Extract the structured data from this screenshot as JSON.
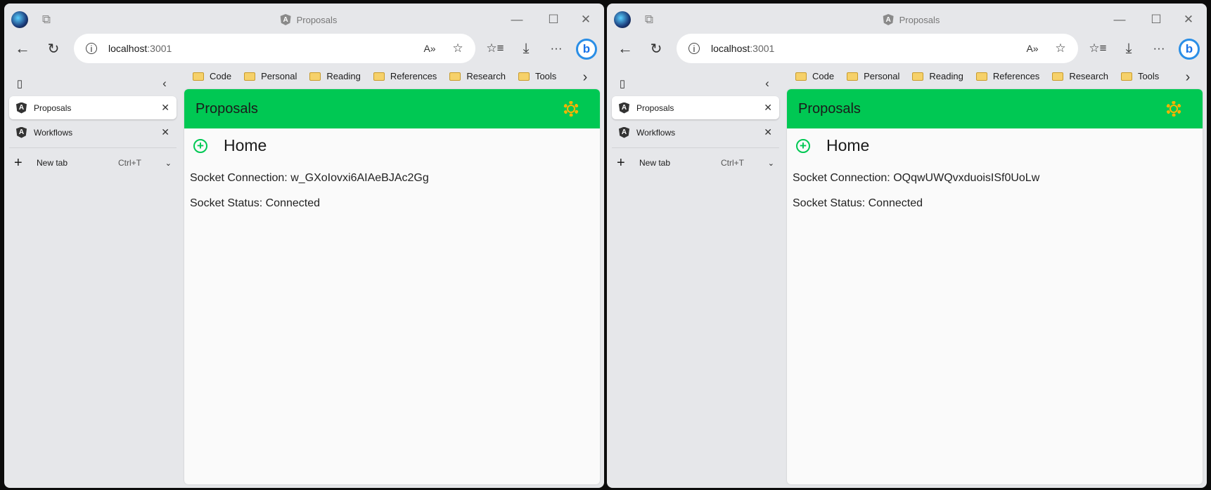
{
  "windows": [
    {
      "title": "Proposals",
      "url_host": "localhost",
      "url_port": ":3001",
      "bookmarks": [
        "Code",
        "Personal",
        "Reading",
        "References",
        "Research",
        "Tools"
      ],
      "tabs": [
        {
          "label": "Proposals",
          "active": true
        },
        {
          "label": "Workflows",
          "active": false
        }
      ],
      "new_tab": {
        "label": "New tab",
        "shortcut": "Ctrl+T"
      },
      "app": {
        "header": "Proposals",
        "home": "Home",
        "socket_connection": "Socket Connection: w_GXoIovxi6AIAeBJAc2Gg",
        "socket_status": "Socket Status: Connected"
      }
    },
    {
      "title": "Proposals",
      "url_host": "localhost",
      "url_port": ":3001",
      "bookmarks": [
        "Code",
        "Personal",
        "Reading",
        "References",
        "Research",
        "Tools"
      ],
      "tabs": [
        {
          "label": "Proposals",
          "active": true
        },
        {
          "label": "Workflows",
          "active": false
        }
      ],
      "new_tab": {
        "label": "New tab",
        "shortcut": "Ctrl+T"
      },
      "app": {
        "header": "Proposals",
        "home": "Home",
        "socket_connection": "Socket Connection: OQqwUWQvxduoisISf0UoLw",
        "socket_status": "Socket Status: Connected"
      }
    }
  ],
  "colors": {
    "app_header": "#00c853",
    "theme_icon": "#ffb300",
    "add_icon": "#00c853"
  },
  "icons": {
    "theme_toggle": "sun-icon",
    "add": "plus-circle-icon",
    "tab_favicon": "angular-icon"
  }
}
